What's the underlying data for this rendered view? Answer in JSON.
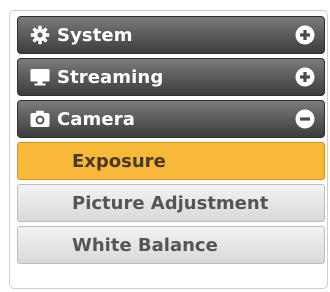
{
  "menu": {
    "system": {
      "label": "System",
      "icon": "gear-icon",
      "toggle": "plus-circle-icon"
    },
    "streaming": {
      "label": "Streaming",
      "icon": "monitor-icon",
      "toggle": "plus-circle-icon"
    },
    "camera": {
      "label": "Camera",
      "icon": "camera-icon",
      "toggle": "minus-circle-icon",
      "items": [
        {
          "label": "Exposure",
          "active": true
        },
        {
          "label": "Picture Adjustment",
          "active": false
        },
        {
          "label": "White Balance",
          "active": false
        }
      ]
    }
  },
  "colors": {
    "header_gradient_top": "#7c7c7c",
    "header_gradient_bottom": "#3d3d3d",
    "active_item": "#f8b83a",
    "inactive_item": "#e4e4e4"
  }
}
